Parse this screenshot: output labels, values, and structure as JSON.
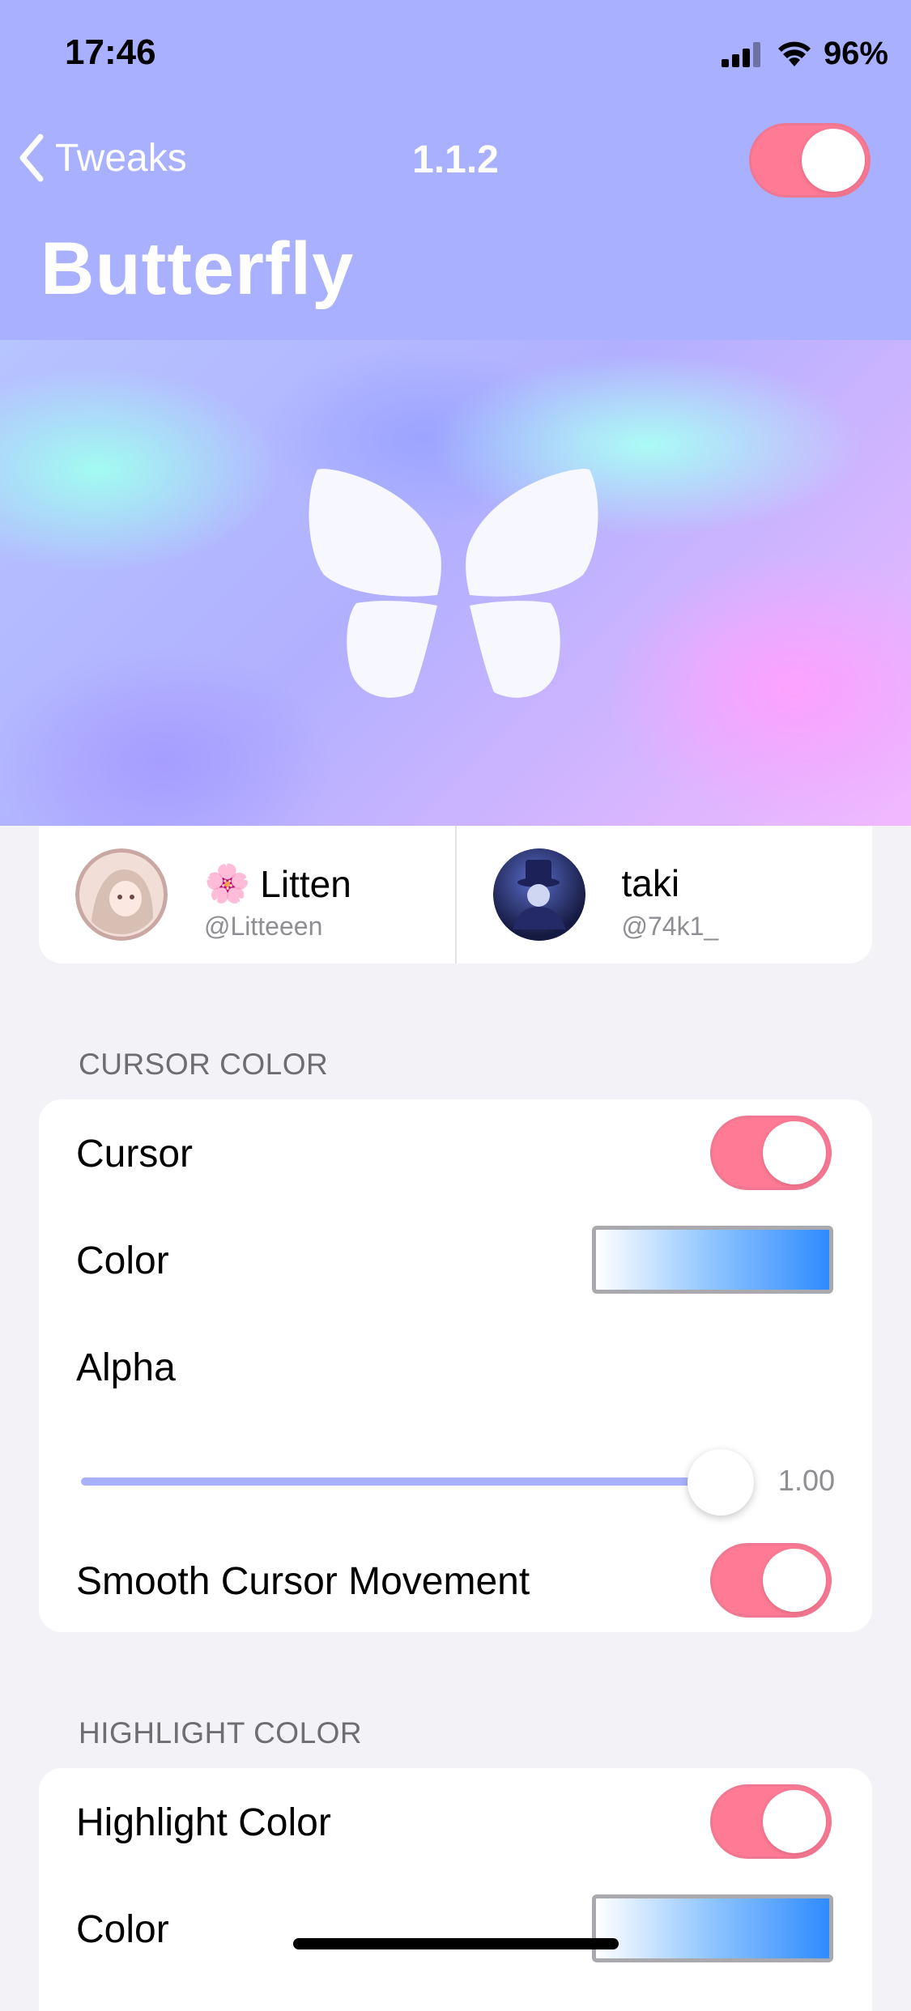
{
  "status": {
    "time": "17:46",
    "battery": "96%"
  },
  "nav": {
    "back_label": "Tweaks",
    "version": "1.1.2",
    "enabled": true
  },
  "title": "Butterfly",
  "credits": [
    {
      "name": "Litten",
      "handle": "@Litteeen",
      "emoji": "🌸"
    },
    {
      "name": "taki",
      "handle": "@74k1_"
    }
  ],
  "cursor_section": {
    "header": "CURSOR COLOR",
    "cursor_label": "Cursor",
    "cursor_enabled": true,
    "color_label": "Color",
    "alpha_label": "Alpha",
    "alpha_value": "1.00",
    "alpha_fraction": 1.0,
    "smooth_label": "Smooth Cursor Movement",
    "smooth_enabled": true
  },
  "highlight_section": {
    "header": "HIGHLIGHT COLOR",
    "highlight_label": "Highlight Color",
    "highlight_enabled": true,
    "color_label": "Color"
  },
  "colors": {
    "header_bg": "#a8b0ff",
    "toggle_on": "#ff7a95",
    "slider": "#a9b0ff",
    "page_bg": "#f2f2f7"
  }
}
